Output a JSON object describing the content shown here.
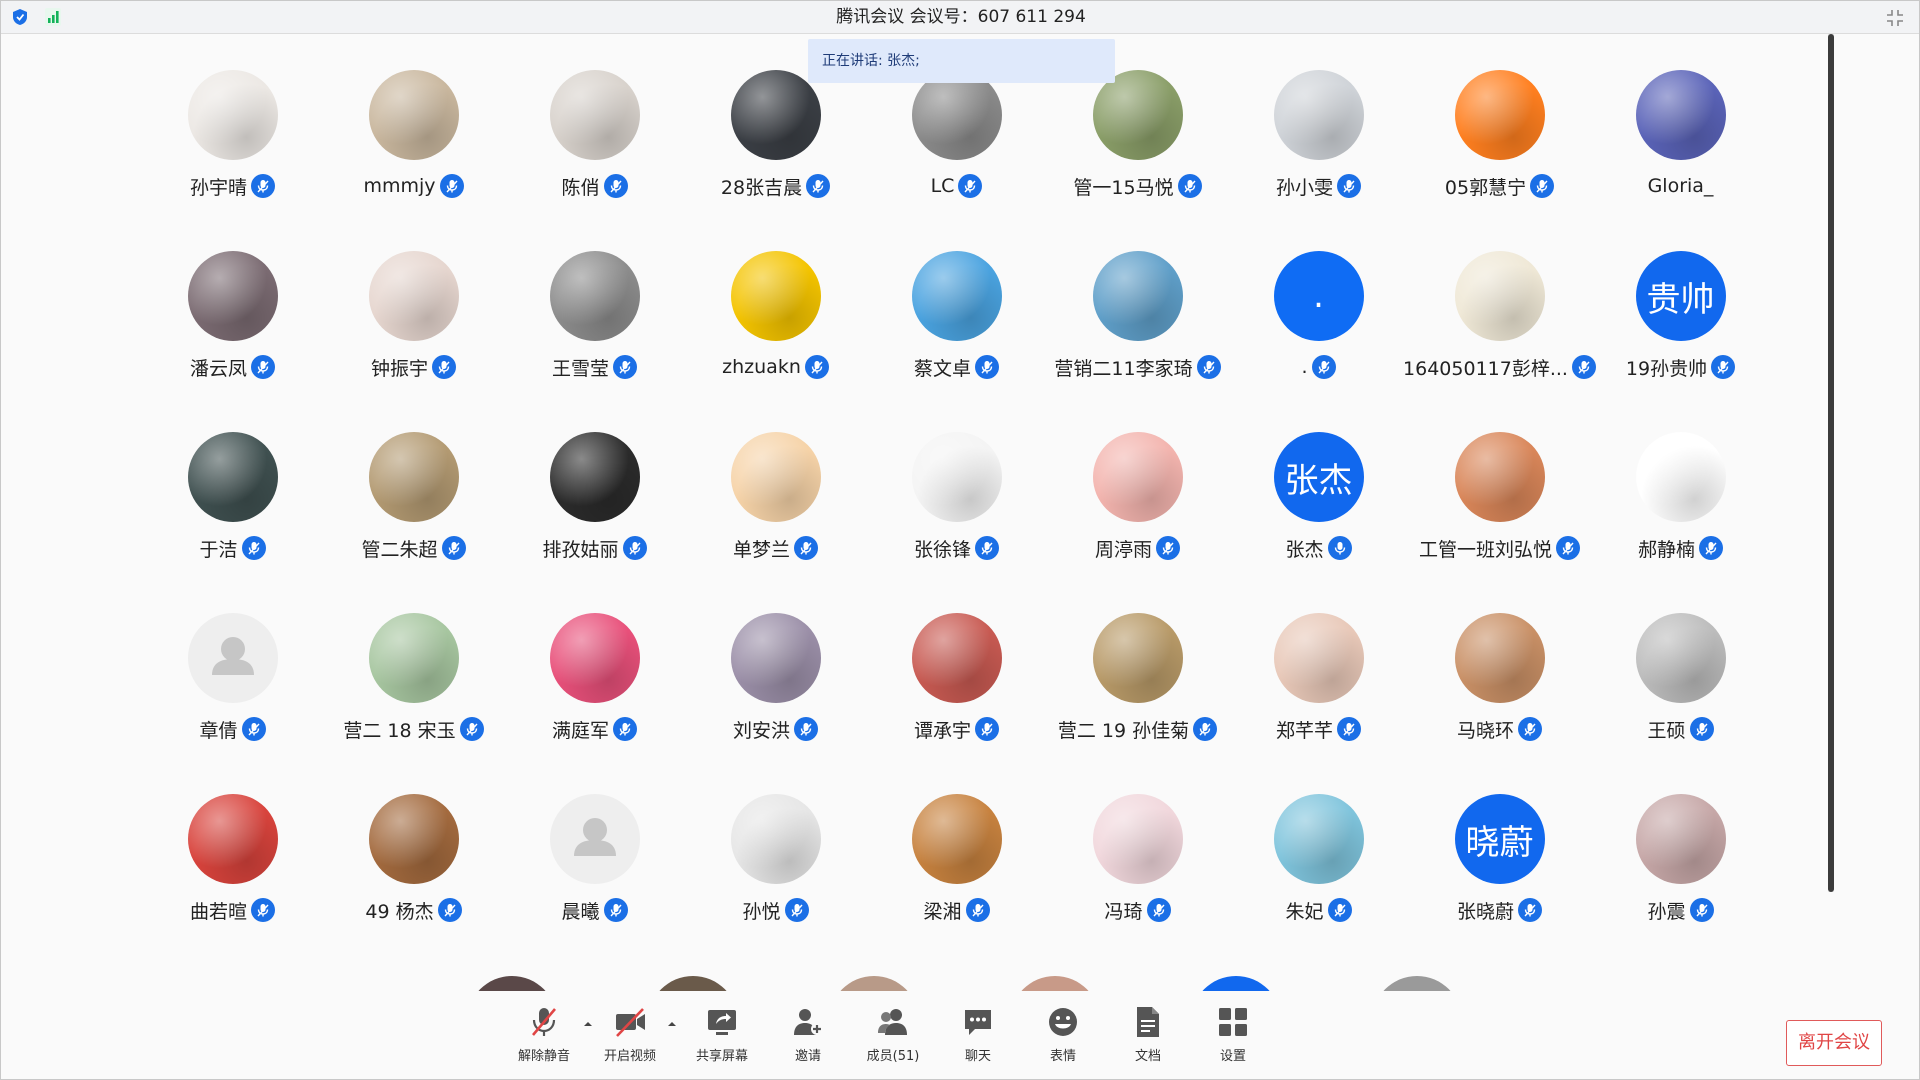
{
  "window": {
    "title": "腾讯会议 会议号：607 611 294"
  },
  "speaking": {
    "prefix": "正在讲话:",
    "name": "张杰;"
  },
  "participants": [
    {
      "name": "孙宇晴",
      "avatar_color": "#ece8e4"
    },
    {
      "name": "mmmjy",
      "avatar_color": "#c9b79e"
    },
    {
      "name": "陈俏",
      "avatar_color": "#d8d2cc"
    },
    {
      "name": "28张吉晨",
      "avatar_color": "#3b3f45"
    },
    {
      "name": "LC",
      "avatar_color": "#8b8b8b"
    },
    {
      "name": "管一15马悦",
      "avatar_color": "#8a9e68"
    },
    {
      "name": "孙小雯",
      "avatar_color": "#cfd3d8"
    },
    {
      "name": "05郭慧宁",
      "avatar_color": "#ff7f1f"
    },
    {
      "name": "Gloria_",
      "avatar_color": "#5a63b8"
    },
    {
      "name": "潘云凤",
      "avatar_color": "#7b6b72"
    },
    {
      "name": "钟振宇",
      "avatar_color": "#e6d6cf"
    },
    {
      "name": "王雪莹",
      "avatar_color": "#8c8c8c"
    },
    {
      "name": "zhzuakn",
      "avatar_color": "#f4c400"
    },
    {
      "name": "蔡文卓",
      "avatar_color": "#4aa3e0"
    },
    {
      "name": "营销二11李家琦",
      "avatar_color": "#5f9fc9"
    },
    {
      "name": ".",
      "avatar_color": "#0f6cf4",
      "avatar_text": "."
    },
    {
      "name": "164050117彭梓...",
      "avatar_color": "#efe8d6"
    },
    {
      "name": "19孙贵帅",
      "avatar_color": "#1168ee",
      "avatar_text": "贵帅"
    },
    {
      "name": "于洁",
      "avatar_color": "#3f5050"
    },
    {
      "name": "管二朱超",
      "avatar_color": "#b39a72"
    },
    {
      "name": "排孜姑丽",
      "avatar_color": "#2b2b2b"
    },
    {
      "name": "单梦兰",
      "avatar_color": "#f6d3a8"
    },
    {
      "name": "张徐锋",
      "avatar_color": "#f4f4f4"
    },
    {
      "name": "周渟雨",
      "avatar_color": "#f3b4ae"
    },
    {
      "name": "张杰",
      "avatar_color": "#1168ee",
      "avatar_text": "张杰",
      "speaking": true
    },
    {
      "name": "工管一班刘弘悦",
      "avatar_color": "#d98659"
    },
    {
      "name": "郝静楠",
      "avatar_color": "#ffffff"
    },
    {
      "name": "章倩",
      "avatar_color": "#eeeeee",
      "placeholder": true
    },
    {
      "name": "营二 18 宋玉",
      "avatar_color": "#a7c6a0"
    },
    {
      "name": "满庭军",
      "avatar_color": "#e8507a"
    },
    {
      "name": "刘安洪",
      "avatar_color": "#9b8fa8"
    },
    {
      "name": "谭承宇",
      "avatar_color": "#c85a52"
    },
    {
      "name": "营二 19 孙佳菊",
      "avatar_color": "#b89a68"
    },
    {
      "name": "郑芊芊",
      "avatar_color": "#e8c8b8"
    },
    {
      "name": "马晓环",
      "avatar_color": "#c99066"
    },
    {
      "name": "王硕",
      "avatar_color": "#bcbcbc"
    },
    {
      "name": "曲若暄",
      "avatar_color": "#d8433c"
    },
    {
      "name": "49 杨杰",
      "avatar_color": "#a36a3e"
    },
    {
      "name": "晨曦",
      "avatar_color": "#eeeeee",
      "placeholder": true
    },
    {
      "name": "孙悦",
      "avatar_color": "#e6e6e6"
    },
    {
      "name": "梁湘",
      "avatar_color": "#c7823f"
    },
    {
      "name": "冯琦",
      "avatar_color": "#f1d7dc"
    },
    {
      "name": "朱妃",
      "avatar_color": "#7fc4dc"
    },
    {
      "name": "张晓蔚",
      "avatar_color": "#1168ee",
      "avatar_text": "晓蔚"
    },
    {
      "name": "孙震",
      "avatar_color": "#c6a7a7"
    }
  ],
  "partial_row_colors": [
    "#5a4848",
    "#6a5a4a",
    "#b89a88",
    "#c89a88",
    "#1168ee",
    "#9a9a9a"
  ],
  "toolbar": {
    "unmute": "解除静音",
    "video": "开启视频",
    "share": "共享屏幕",
    "invite": "邀请",
    "members": "成员(51)",
    "chat": "聊天",
    "emoji": "表情",
    "docs": "文档",
    "settings": "设置",
    "leave": "离开会议"
  },
  "colors": {
    "accent": "#1b6fe6",
    "danger": "#e04545"
  }
}
